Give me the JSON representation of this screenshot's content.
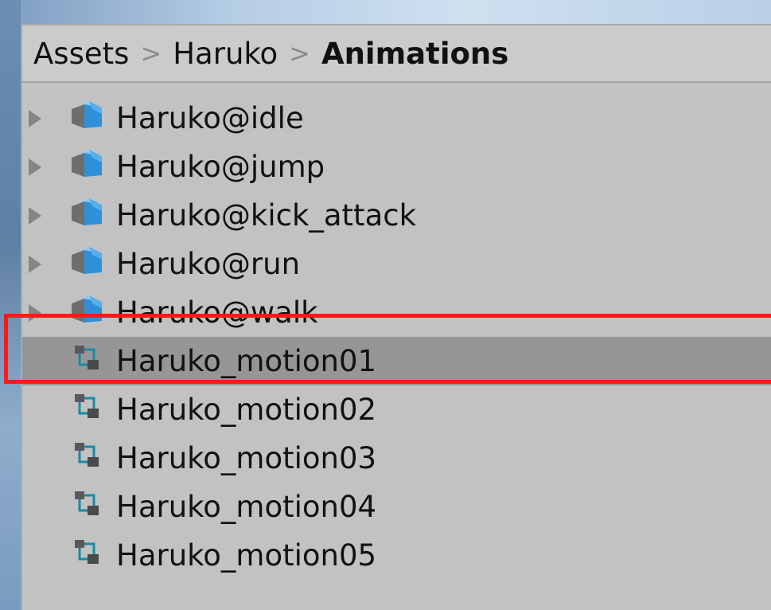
{
  "breadcrumb": {
    "items": [
      "Assets",
      "Haruko",
      "Animations"
    ],
    "separator": ">"
  },
  "files": [
    {
      "name": "Haruko@idle",
      "icon": "model-prefab-icon",
      "expandable": true,
      "selected": false
    },
    {
      "name": "Haruko@jump",
      "icon": "model-prefab-icon",
      "expandable": true,
      "selected": false
    },
    {
      "name": "Haruko@kick_attack",
      "icon": "model-prefab-icon",
      "expandable": true,
      "selected": false
    },
    {
      "name": "Haruko@run",
      "icon": "model-prefab-icon",
      "expandable": true,
      "selected": false
    },
    {
      "name": "Haruko@walk",
      "icon": "model-prefab-icon",
      "expandable": true,
      "selected": false
    },
    {
      "name": "Haruko_motion01",
      "icon": "animator-controller-icon",
      "expandable": false,
      "selected": true
    },
    {
      "name": "Haruko_motion02",
      "icon": "animator-controller-icon",
      "expandable": false,
      "selected": false
    },
    {
      "name": "Haruko_motion03",
      "icon": "animator-controller-icon",
      "expandable": false,
      "selected": false
    },
    {
      "name": "Haruko_motion04",
      "icon": "animator-controller-icon",
      "expandable": false,
      "selected": false
    },
    {
      "name": "Haruko_motion05",
      "icon": "animator-controller-icon",
      "expandable": false,
      "selected": false
    }
  ],
  "colors": {
    "panel_bg": "#c2c2c2",
    "selected_row": "#969696",
    "highlight_outline": "#ff1a1a",
    "model_icon_blue": "#2f8fd8",
    "animator_icon_teal": "#1b8aa0"
  }
}
